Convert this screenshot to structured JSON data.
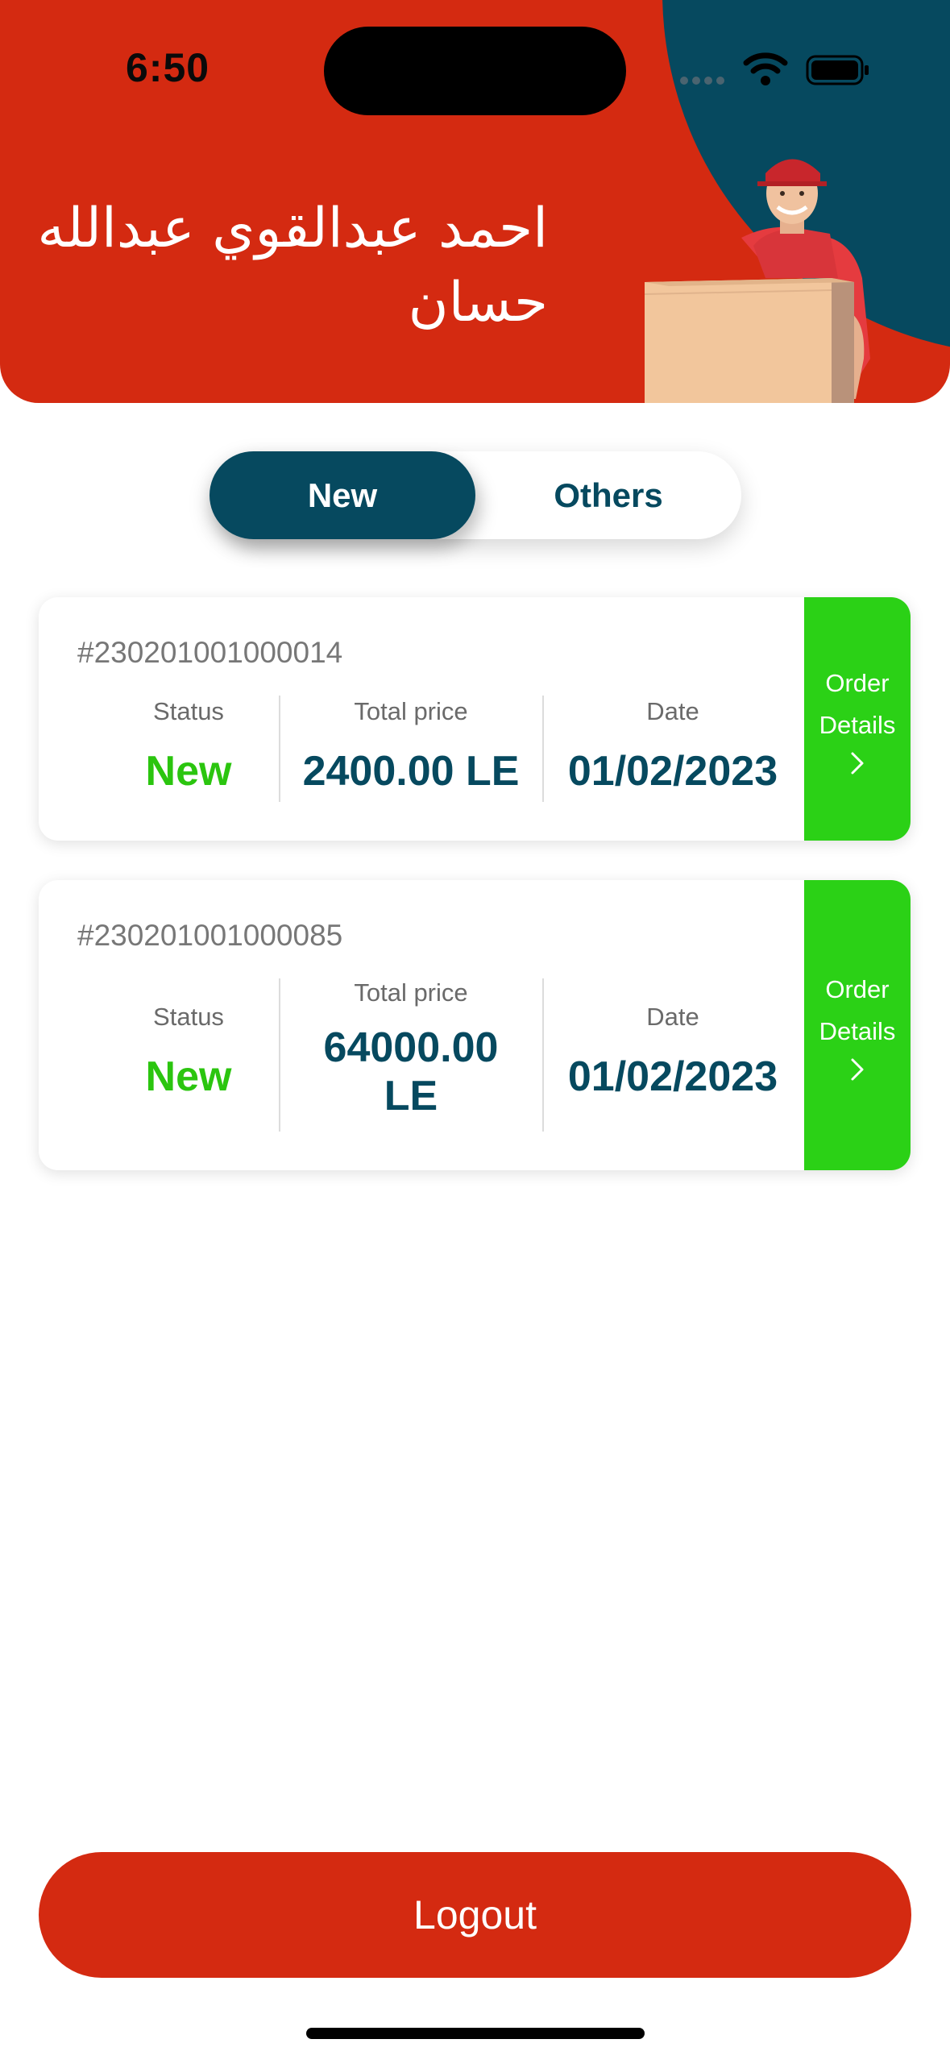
{
  "status_bar": {
    "time": "6:50"
  },
  "header": {
    "user_name": "احمد عبدالقوي عبدالله حسان"
  },
  "tabs": [
    {
      "label": "New",
      "selected": true
    },
    {
      "label": "Others",
      "selected": false
    }
  ],
  "orders": [
    {
      "id": "#230201001000014",
      "status_label": "Status",
      "status": "New",
      "price_label": "Total price",
      "price": "2400.00 LE",
      "date_label": "Date",
      "date": "01/02/2023",
      "details_label": "Order Details"
    },
    {
      "id": "#230201001000085",
      "status_label": "Status",
      "status": "New",
      "price_label": "Total price",
      "price": "64000.00 LE",
      "date_label": "Date",
      "date": "01/02/2023",
      "details_label": "Order Details"
    }
  ],
  "logout_label": "Logout",
  "colors": {
    "brand_red": "#d42a11",
    "brand_teal": "#06495f",
    "status_green": "#2bc50f",
    "details_green": "#2bd116"
  }
}
